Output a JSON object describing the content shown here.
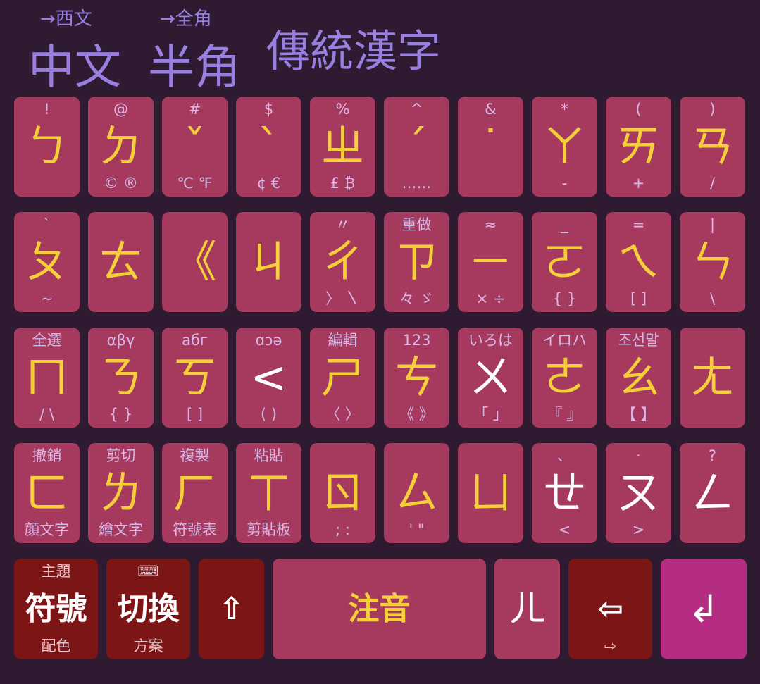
{
  "colors": {
    "background": "#2e1b32",
    "key": "#a53a5e",
    "key_dark": "#7c1515",
    "key_enter": "#b52c83",
    "label_yellow": "#f5cf3a",
    "label_hint": "#d8b8e8",
    "toggle_purple": "#9a7fe0"
  },
  "topbar": {
    "lang": {
      "hint": "→西文",
      "label": "中文"
    },
    "width": {
      "hint": "→全角",
      "label": "半角"
    },
    "script": {
      "label": "傳統漢字"
    }
  },
  "rows": [
    [
      {
        "top": "!",
        "main": "ㄅ",
        "bot": ""
      },
      {
        "top": "@",
        "main": "ㄉ",
        "bot": "©  ®"
      },
      {
        "top": "#",
        "main": "ˇ",
        "bot": "℃  ℉"
      },
      {
        "top": "$",
        "main": "ˋ",
        "bot": "¢  €"
      },
      {
        "top": "%",
        "main": "ㄓ",
        "bot": "£  ₿"
      },
      {
        "top": "^",
        "main": "ˊ",
        "bot": "……"
      },
      {
        "top": "&",
        "main": "˙",
        "bot": ""
      },
      {
        "top": "*",
        "main": "ㄚ",
        "bot": "-"
      },
      {
        "top": "(",
        "main": "ㄞ",
        "bot": "+"
      },
      {
        "top": ")",
        "main": "ㄢ",
        "bot": "/"
      }
    ],
    [
      {
        "top": "`",
        "main": "ㄆ",
        "bot": "~"
      },
      {
        "top": "",
        "main": "ㄊ",
        "bot": ""
      },
      {
        "top": "",
        "main": "《",
        "bot": ""
      },
      {
        "top": "",
        "main": "ㄐ",
        "bot": ""
      },
      {
        "top": "〃",
        "main": "ㄔ",
        "bot": "〉  〵"
      },
      {
        "top": "重做",
        "main": "ㄗ",
        "bot": "々  ゞ"
      },
      {
        "top": "≈",
        "main": "ㄧ",
        "bot": "×  ÷"
      },
      {
        "top": "_",
        "main": "ㄛ",
        "bot": "{ }"
      },
      {
        "top": "=",
        "main": "ㄟ",
        "bot": "[ ]"
      },
      {
        "top": "|",
        "main": "ㄣ",
        "bot": "\\"
      }
    ],
    [
      {
        "top": "全選",
        "main": "ㄇ",
        "bot": "/  \\"
      },
      {
        "top": "αβγ",
        "main": "ㄋ",
        "bot": "{ }"
      },
      {
        "top": "абг",
        "main": "ㄎ",
        "bot": "[ ]"
      },
      {
        "top": "ɑɔə",
        "main": "<",
        "bot": "( )",
        "white": true
      },
      {
        "top": "編輯",
        "main": "ㄕ",
        "bot": "〈 〉"
      },
      {
        "top": "123",
        "main": "ㄘ",
        "bot": "《 》"
      },
      {
        "top": "いろは",
        "main": "ㄨ",
        "bot": "「 」",
        "white": true
      },
      {
        "top": "イロハ",
        "main": "ㄜ",
        "bot": "『 』"
      },
      {
        "top": "조선말",
        "main": "ㄠ",
        "bot": "【 】"
      },
      {
        "top": "",
        "main": "ㄤ",
        "bot": ""
      }
    ],
    [
      {
        "top": "撤銷",
        "main": "ㄈ",
        "bot": "顏文字"
      },
      {
        "top": "剪切",
        "main": "ㄌ",
        "bot": "繪文字"
      },
      {
        "top": "複製",
        "main": "ㄏ",
        "bot": "符號表"
      },
      {
        "top": "粘貼",
        "main": "ㄒ",
        "bot": "剪貼板"
      },
      {
        "top": "",
        "main": "ㄖ",
        "bot": ";  :"
      },
      {
        "top": "",
        "main": "ㄙ",
        "bot": "'  \""
      },
      {
        "top": "",
        "main": "ㄩ",
        "bot": ""
      },
      {
        "top": "、",
        "main": "ㄝ",
        "bot": "<",
        "white": true
      },
      {
        "top": "·",
        "main": "ㄡ",
        "bot": ">",
        "white": true
      },
      {
        "top": "?",
        "main": "ㄥ",
        "bot": "",
        "white": true
      }
    ]
  ],
  "bottom": {
    "symbols": {
      "top": "主題",
      "main": "符號",
      "bot": "配色"
    },
    "switch": {
      "top": "⌨",
      "main": "切換",
      "bot": "方案"
    },
    "shift": {
      "main": "⇧"
    },
    "space": {
      "main": "注音"
    },
    "er": {
      "main": "ㄦ"
    },
    "backspace": {
      "main": "⇦",
      "bot": "⇨"
    },
    "enter": {
      "main": "↲"
    }
  }
}
